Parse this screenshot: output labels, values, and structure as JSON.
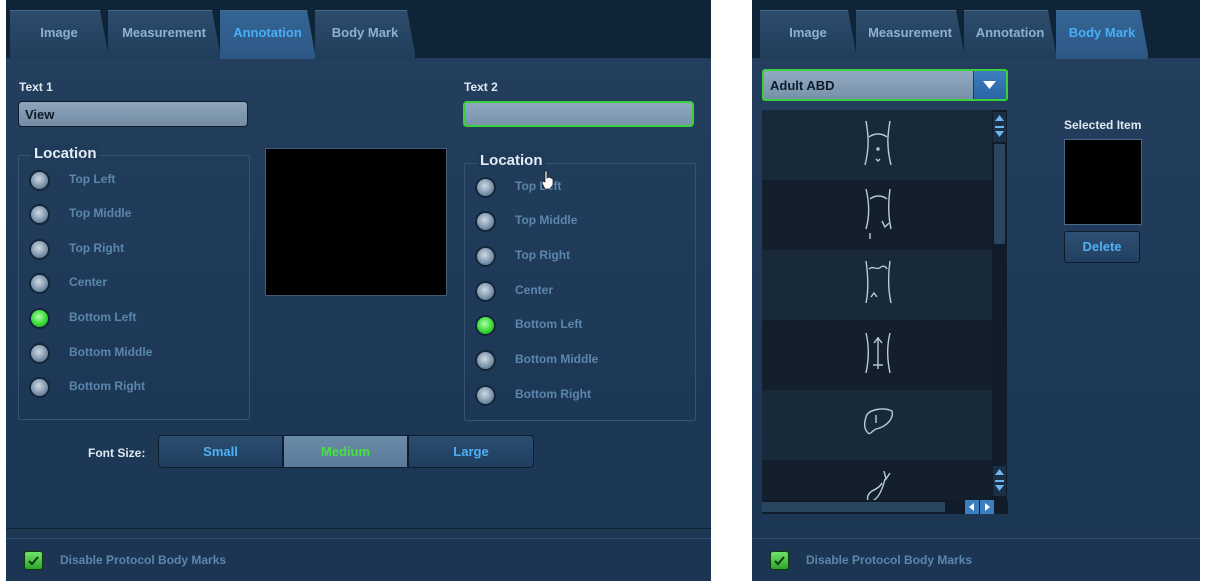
{
  "left_panel": {
    "tabs": [
      "Image",
      "Measurement",
      "Annotation",
      "Body Mark"
    ],
    "active_tab": "Annotation",
    "text1": {
      "label": "Text 1",
      "value": "View"
    },
    "text2": {
      "label": "Text 2",
      "value": ""
    },
    "location1": {
      "title": "Location",
      "options": [
        "Top Left",
        "Top Middle",
        "Top Right",
        "Center",
        "Bottom Left",
        "Bottom Middle",
        "Bottom Right"
      ],
      "selected": "Bottom Left"
    },
    "location2": {
      "title": "Location",
      "options": [
        "Top Left",
        "Top Middle",
        "Top Right",
        "Center",
        "Bottom Left",
        "Bottom Middle",
        "Bottom Right"
      ],
      "selected": "Bottom Left"
    },
    "font_size": {
      "label": "Font Size:",
      "options": [
        "Small",
        "Medium",
        "Large"
      ],
      "selected": "Medium"
    },
    "footer": {
      "checkbox_label": "Disable Protocol Body Marks",
      "checked": true
    }
  },
  "right_panel": {
    "tabs": [
      "Image",
      "Measurement",
      "Annotation",
      "Body Mark"
    ],
    "active_tab": "Body Mark",
    "dropdown": {
      "value": "Adult ABD"
    },
    "body_marks": [
      "torso-front-icon",
      "torso-side-icon",
      "torso-back-icon",
      "torso-spine-icon",
      "liver-icon",
      "gallbladder-icon"
    ],
    "selected_item_label": "Selected Item",
    "delete_label": "Delete",
    "footer": {
      "checkbox_label": "Disable Protocol Body Marks",
      "checked": true
    }
  },
  "colors": {
    "panel_bg": "#1f3b59",
    "tab_bar_bg": "#0f2436",
    "active_tab_text": "#49aef5",
    "focus_green": "#3ccf3c",
    "radio_checked": "#39d935",
    "segment_selected_text": "#47e043"
  }
}
